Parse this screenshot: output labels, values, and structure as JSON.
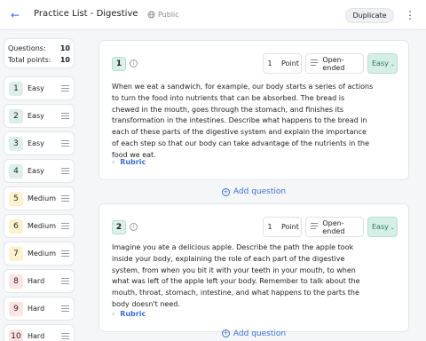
{
  "header": {
    "title": "Practice List - Digestive Sy...",
    "visibility": "Public",
    "duplicate_label": "Duplicate"
  },
  "summary": {
    "questions_label": "Questions:",
    "questions_value": "10",
    "points_label": "Total points:",
    "points_value": "10"
  },
  "questions_list": [
    {
      "num": "1",
      "label": "Easy",
      "color": "#dcefe9"
    },
    {
      "num": "2",
      "label": "Easy",
      "color": "#dcefe9"
    },
    {
      "num": "3",
      "label": "Easy",
      "color": "#dcefe9"
    },
    {
      "num": "4",
      "label": "Easy",
      "color": "#dcefe9"
    },
    {
      "num": "5",
      "label": "Medium",
      "color": "#fdf1cf"
    },
    {
      "num": "6",
      "label": "Medium",
      "color": "#fdf1cf"
    },
    {
      "num": "7",
      "label": "Medium",
      "color": "#fdf1cf"
    },
    {
      "num": "8",
      "label": "Hard",
      "color": "#fde3e1"
    },
    {
      "num": "9",
      "label": "Hard",
      "color": "#fde3e1"
    },
    {
      "num": "10",
      "label": "Hard",
      "color": "#fde3e1"
    }
  ],
  "cards": [
    {
      "num": "1",
      "points_value": "1",
      "points_label": "Point",
      "type": "Open-ended",
      "difficulty": "Easy",
      "text": "When we eat a sandwich, for example, our body starts a series of actions to turn the food into nutrients that can be absorbed. The bread is chewed in the mouth, goes through the stomach, and finishes its transformation in the intestines. Describe what happens to the bread in each of these parts of the digestive system and explain the importance of each step so that our body can take advantage of the nutrients in the food we eat.",
      "rubric": "Rubric"
    },
    {
      "num": "2",
      "points_value": "1",
      "points_label": "Point",
      "type": "Open-ended",
      "difficulty": "Easy",
      "text": "Imagine you ate a delicious apple. Describe the path the apple took inside your body, explaining the role of each part of the digestive system, from when you bit it with your teeth in your mouth, to when what was left of the apple left your body. Remember to talk about the mouth, throat, stomach, intestine, and what happens to the parts the body doesn't need.",
      "rubric": "Rubric"
    }
  ],
  "add_question_label": "Add question",
  "colors": {
    "accent": "#3b6fd8",
    "easy": "#dcefe9",
    "medium": "#fdf1cf",
    "hard": "#fde3e1"
  }
}
